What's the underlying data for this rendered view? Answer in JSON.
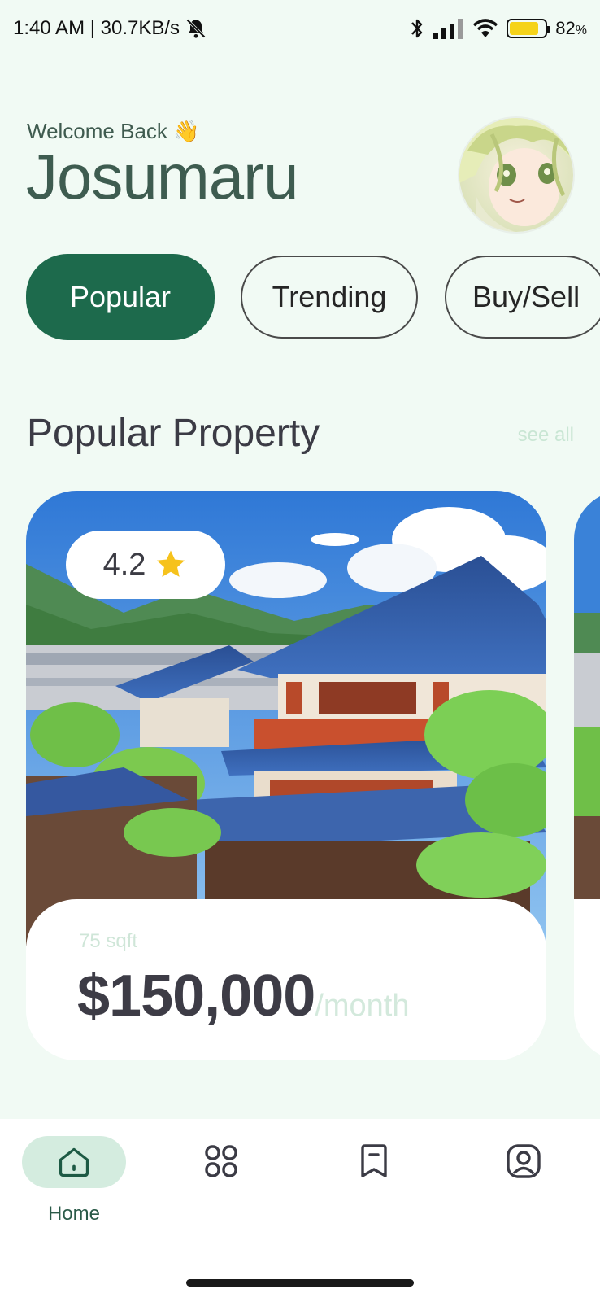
{
  "status_bar": {
    "time_speed": "1:40 AM | 30.7KB/s",
    "battery_pct": "82",
    "battery_unit": "%",
    "battery_level": 0.82,
    "icons": [
      "mute-bell-icon",
      "bluetooth-icon",
      "signal-icon",
      "wifi-icon",
      "battery-icon"
    ]
  },
  "header": {
    "welcome": "Welcome Back 👋",
    "username": "Josumaru"
  },
  "tabs": [
    {
      "label": "Popular",
      "active": true
    },
    {
      "label": "Trending",
      "active": false
    },
    {
      "label": "Buy/Sell",
      "active": false
    }
  ],
  "section": {
    "title": "Popular Property",
    "see_all": "see all"
  },
  "card": {
    "rating": "4.2",
    "area": "75 sqft",
    "price": "$150,000",
    "period": "/month"
  },
  "bottom_nav": {
    "items": [
      {
        "label": "Home",
        "icon": "home-icon",
        "active": true
      },
      {
        "label": "",
        "icon": "grid-icon",
        "active": false
      },
      {
        "label": "",
        "icon": "bookmark-icon",
        "active": false
      },
      {
        "label": "",
        "icon": "profile-icon",
        "active": false
      }
    ]
  },
  "colors": {
    "background": "#f1faf4",
    "primary": "#1d6a4c",
    "pill": "#d4ecdf"
  }
}
